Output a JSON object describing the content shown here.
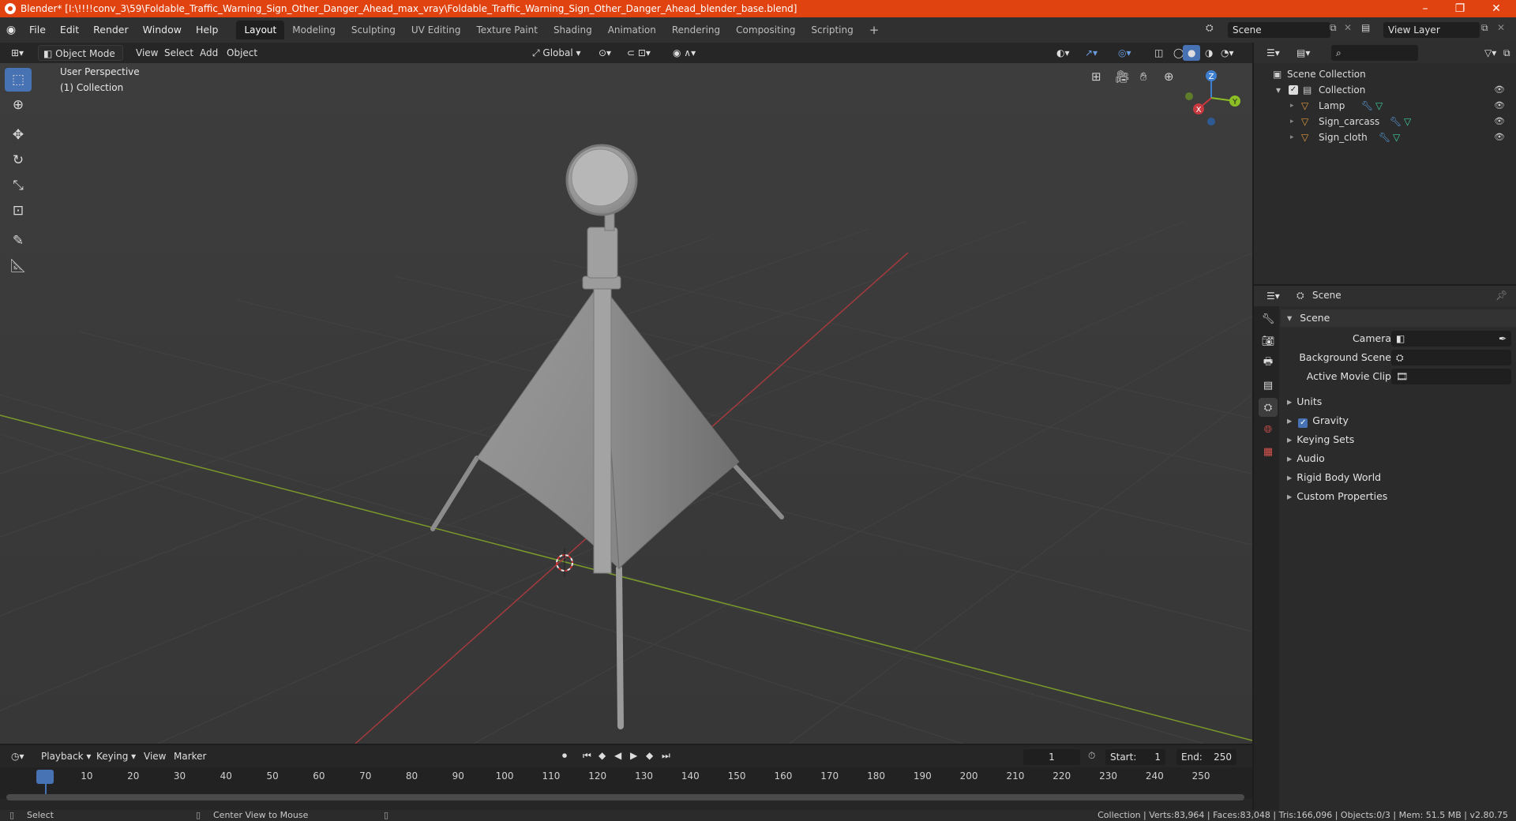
{
  "titlebar": {
    "title": "Blender* [I:\\!!!!conv_3\\59\\Foldable_Traffic_Warning_Sign_Other_Danger_Ahead_max_vray\\Foldable_Traffic_Warning_Sign_Other_Danger_Ahead_blender_base.blend]",
    "minimize": "–",
    "maximize": "❐",
    "close": "✕"
  },
  "menu": {
    "items": [
      "File",
      "Edit",
      "Render",
      "Window",
      "Help"
    ]
  },
  "workspaces": {
    "tabs": [
      "Layout",
      "Modeling",
      "Sculpting",
      "UV Editing",
      "Texture Paint",
      "Shading",
      "Animation",
      "Rendering",
      "Compositing",
      "Scripting"
    ],
    "active": "Layout",
    "add": "+"
  },
  "scene_selector": {
    "value": "Scene"
  },
  "viewlayer_selector": {
    "value": "View Layer"
  },
  "viewport_header": {
    "mode": "Object Mode",
    "view": "View",
    "select": "Select",
    "add": "Add",
    "object": "Object",
    "orientation": "Global"
  },
  "viewport": {
    "perspective": "User Perspective",
    "collection": "(1) Collection",
    "gizmo": {
      "x": "X",
      "y": "Y",
      "z": "Z"
    }
  },
  "timeline": {
    "playback": "Playback",
    "keying": "Keying",
    "view": "View",
    "marker": "Marker",
    "current_frame": "1",
    "start_label": "Start:",
    "start": "1",
    "end_label": "End:",
    "end": "250",
    "ticks": [
      "1",
      "10",
      "20",
      "30",
      "40",
      "50",
      "60",
      "70",
      "80",
      "90",
      "100",
      "110",
      "120",
      "130",
      "140",
      "150",
      "160",
      "170",
      "180",
      "190",
      "200",
      "210",
      "220",
      "230",
      "240",
      "250"
    ]
  },
  "statusbar": {
    "select": "Select",
    "center_view": "Center View to Mouse",
    "stats": "Collection | Verts:83,964 | Faces:83,048 | Tris:166,096 | Objects:0/3 | Mem: 51.5 MB | v2.80.75"
  },
  "outliner": {
    "root": "Scene Collection",
    "collection": "Collection",
    "objects": [
      "Lamp",
      "Sign_carcass",
      "Sign_cloth"
    ]
  },
  "properties": {
    "context": "Scene",
    "panel": "Scene",
    "camera_label": "Camera",
    "background_label": "Background Scene",
    "movieclip_label": "Active Movie Clip",
    "sections": [
      "Units",
      "Gravity",
      "Keying Sets",
      "Audio",
      "Rigid Body World",
      "Custom Properties"
    ],
    "gravity_checked": true
  },
  "colors": {
    "accent": "#4772b3",
    "titlebar": "#e0430f",
    "x_axis": "#c8393f",
    "y_axis": "#8bbf25",
    "z_axis": "#3f7fcf"
  }
}
